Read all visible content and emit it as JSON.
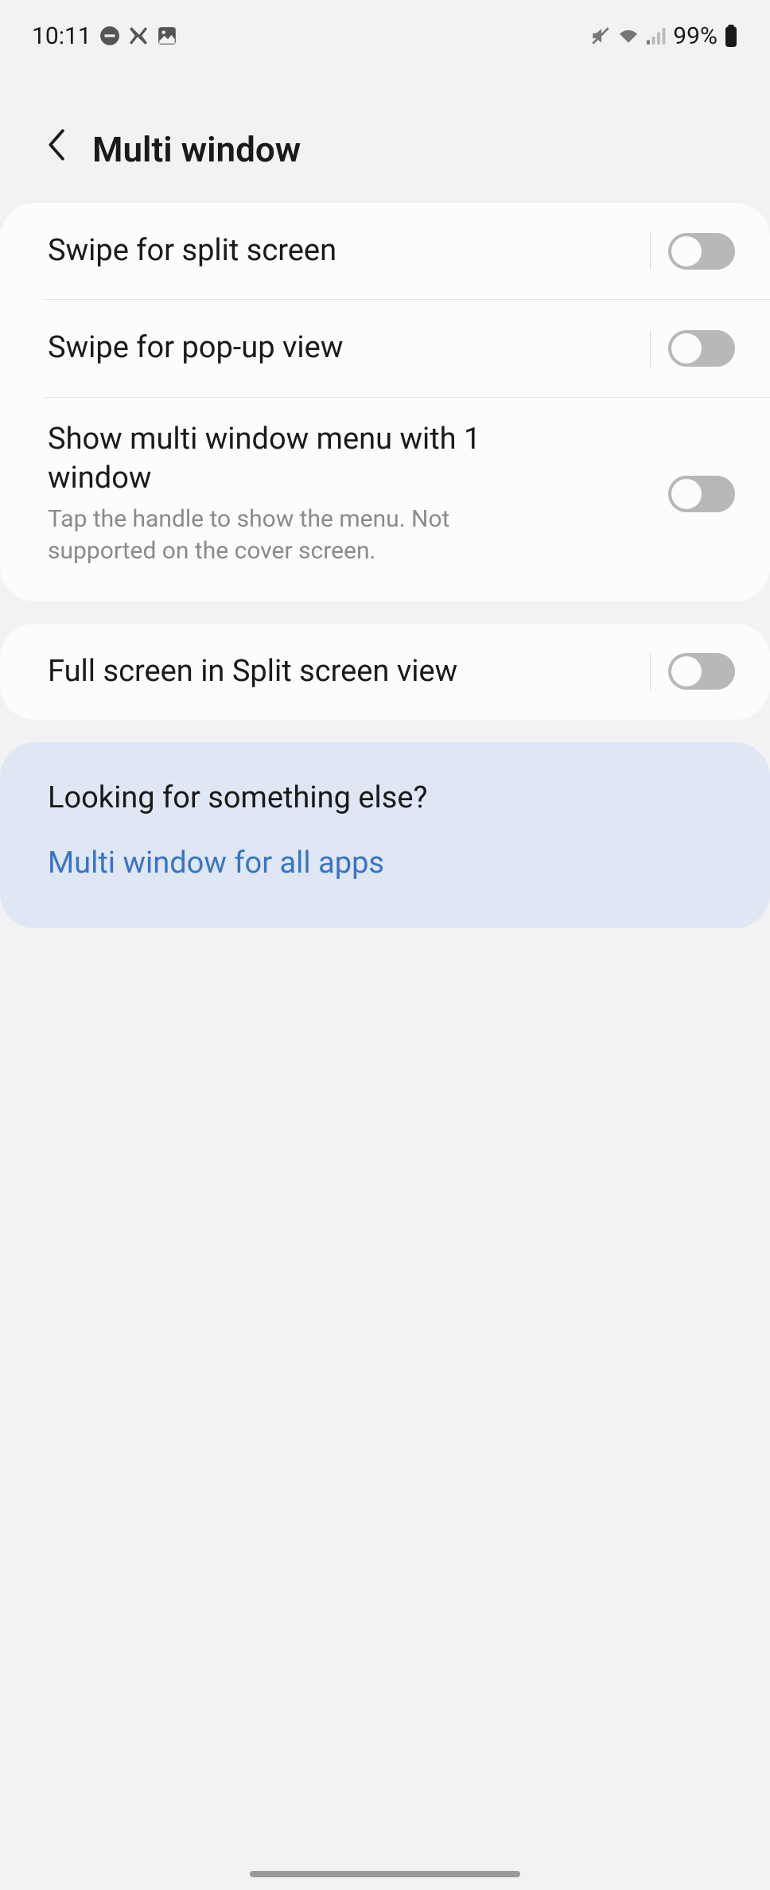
{
  "status": {
    "time": "10:11",
    "battery": "99%"
  },
  "header": {
    "title": "Multi window"
  },
  "settings": {
    "group1": {
      "item0": {
        "label": "Swipe for split screen"
      },
      "item1": {
        "label": "Swipe for pop-up view"
      },
      "item2": {
        "label": "Show multi window menu with 1 window",
        "desc": "Tap the handle to show the menu. Not supported on the cover screen."
      }
    },
    "group2": {
      "item0": {
        "label": "Full screen in Split screen view"
      }
    }
  },
  "info": {
    "heading": "Looking for something else?",
    "link": "Multi window for all apps"
  }
}
